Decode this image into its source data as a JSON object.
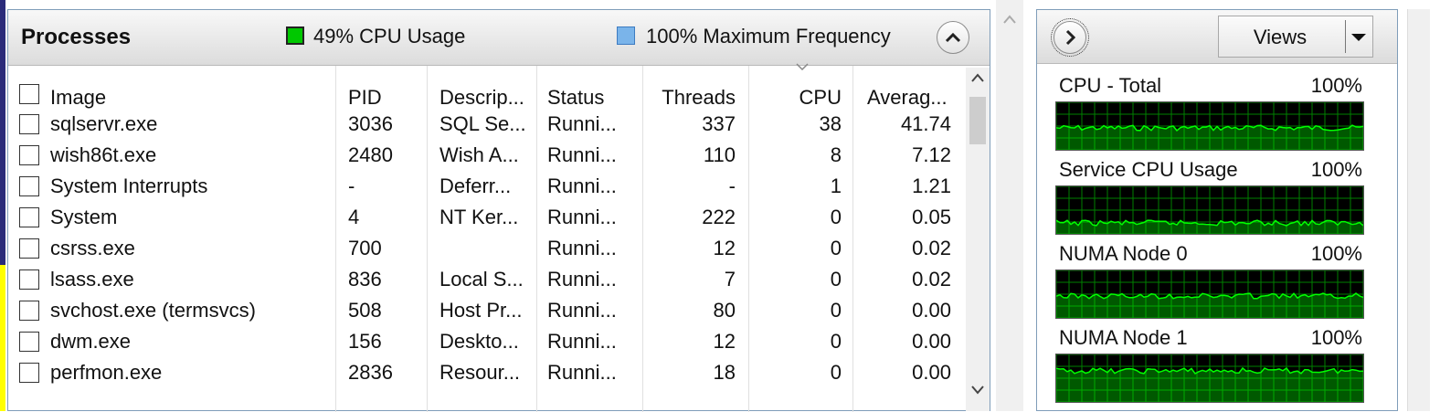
{
  "processes": {
    "title": "Processes",
    "cpu_usage_legend": "49% CPU Usage",
    "max_freq_legend": "100% Maximum Frequency",
    "columns": [
      "Image",
      "PID",
      "Descrip...",
      "Status",
      "Threads",
      "CPU",
      "Averag..."
    ],
    "rows": [
      {
        "image": "sqlservr.exe",
        "pid": "3036",
        "desc": "SQL Se...",
        "status": "Runni...",
        "threads": "337",
        "cpu": "38",
        "avg": "41.74"
      },
      {
        "image": "wish86t.exe",
        "pid": "2480",
        "desc": "Wish A...",
        "status": "Runni...",
        "threads": "110",
        "cpu": "8",
        "avg": "7.12"
      },
      {
        "image": "System Interrupts",
        "pid": "-",
        "desc": "Deferr...",
        "status": "Runni...",
        "threads": "-",
        "cpu": "1",
        "avg": "1.21"
      },
      {
        "image": "System",
        "pid": "4",
        "desc": "NT Ker...",
        "status": "Runni...",
        "threads": "222",
        "cpu": "0",
        "avg": "0.05"
      },
      {
        "image": "csrss.exe",
        "pid": "700",
        "desc": "",
        "status": "Runni...",
        "threads": "12",
        "cpu": "0",
        "avg": "0.02"
      },
      {
        "image": "lsass.exe",
        "pid": "836",
        "desc": "Local S...",
        "status": "Runni...",
        "threads": "7",
        "cpu": "0",
        "avg": "0.02"
      },
      {
        "image": "svchost.exe (termsvcs)",
        "pid": "508",
        "desc": "Host Pr...",
        "status": "Runni...",
        "threads": "80",
        "cpu": "0",
        "avg": "0.00"
      },
      {
        "image": "dwm.exe",
        "pid": "156",
        "desc": "Deskto...",
        "status": "Runni...",
        "threads": "12",
        "cpu": "0",
        "avg": "0.00"
      },
      {
        "image": "perfmon.exe",
        "pid": "2836",
        "desc": "Resour...",
        "status": "Runni...",
        "threads": "18",
        "cpu": "0",
        "avg": "0.00"
      }
    ]
  },
  "views": {
    "label": "Views",
    "graphs": [
      {
        "label": "CPU - Total",
        "percent": "100%"
      },
      {
        "label": "Service CPU Usage",
        "percent": "100%"
      },
      {
        "label": "NUMA Node 0",
        "percent": "100%"
      },
      {
        "label": "NUMA Node 1",
        "percent": "100%"
      }
    ]
  },
  "colors": {
    "cpu_legend": "#00c800",
    "freq_legend": "#7ab4ea",
    "graph_bg": "#000000",
    "graph_grid": "#008000",
    "graph_line": "#00ff00"
  }
}
